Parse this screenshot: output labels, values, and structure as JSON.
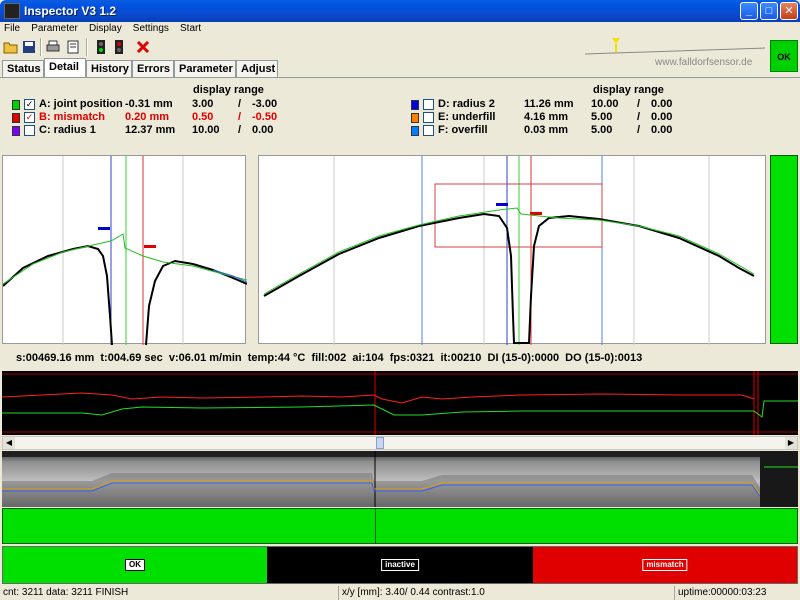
{
  "window": {
    "title": "Inspector V3 1.2"
  },
  "menu": [
    "File",
    "Parameter",
    "Display",
    "Settings",
    "Start"
  ],
  "toolbar": {
    "buttons": [
      "open-icon",
      "save-icon",
      "print-icon",
      "properties-icon",
      "signal-green-icon",
      "signal-red-icon",
      "stop-icon"
    ]
  },
  "header": {
    "website": "www.falldorfsensor.de",
    "ok_label": "OK"
  },
  "tabs": [
    "Status",
    "Detail",
    "History",
    "Errors",
    "Parameter",
    "Adjust"
  ],
  "active_tab": "Detail",
  "channels": {
    "display_range_label": "display range",
    "left": [
      {
        "color": "#00d000",
        "checked": "✓",
        "label": "A: joint position",
        "value": "-0.31 mm",
        "r1": "3.00",
        "sep": "/",
        "r2": "-3.00"
      },
      {
        "color": "#e00000",
        "checked": "✓",
        "label": "B: mismatch",
        "value": "0.20 mm",
        "r1": "0.50",
        "sep": "/",
        "r2": "-0.50"
      },
      {
        "color": "#8000ff",
        "checked": "",
        "label": "C: radius 1",
        "value": "12.37 mm",
        "r1": "10.00",
        "sep": "/",
        "r2": "0.00"
      }
    ],
    "right": [
      {
        "color": "#0000e0",
        "checked": "",
        "label": "D: radius 2",
        "value": "11.26 mm",
        "r1": "10.00",
        "sep": "/",
        "r2": "0.00"
      },
      {
        "color": "#ff8000",
        "checked": "",
        "label": "E: underfill",
        "value": "4.16 mm",
        "r1": "5.00",
        "sep": "/",
        "r2": "0.00"
      },
      {
        "color": "#0080ff",
        "checked": "",
        "label": "F: overfill",
        "value": "0.03 mm",
        "r1": "5.00",
        "sep": "/",
        "r2": "0.00"
      }
    ]
  },
  "status_line": "s:00469.16 mm  t:004.69 sec  v:06.01 m/min  temp:44 °C  fill:002  ai:104  fps:0321  it:00210  DI (15-0):0000  DO (15-0):0013",
  "state_bar": [
    {
      "label": "OK",
      "color": "#00e000"
    },
    {
      "label": "inactive",
      "color": "#000000"
    },
    {
      "label": "mismatch",
      "color": "#e00000"
    }
  ],
  "statusbar": {
    "left": "cnt:  3211 data:  3211 FINISH",
    "middle": "x/y [mm]: 3.40/ 0.44  contrast:1.0",
    "right": "uptime:00000:03:23"
  }
}
